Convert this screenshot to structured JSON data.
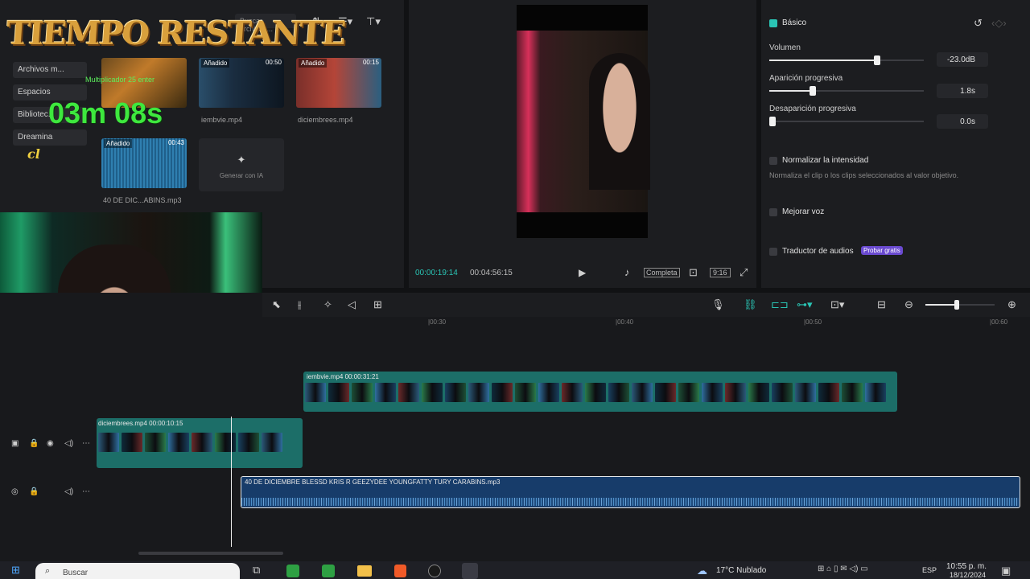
{
  "overlay": {
    "title": "TIEMPO RESTANTE",
    "countdown": "03m 08s",
    "small_text": "Multiplicador 25 enter",
    "signature": "cl"
  },
  "media_panel": {
    "search_placeholder": "Buscar archivos...",
    "sidebar": [
      "Archivos m...",
      "Espacios",
      "Bibliotec...",
      "Dreamina"
    ],
    "items": [
      {
        "name": "",
        "tag": "",
        "duration": ""
      },
      {
        "name": "iembvie.mp4",
        "tag": "Añadido",
        "duration": "00:50"
      },
      {
        "name": "diciembrees.mp4",
        "tag": "Añadido",
        "duration": "00:15"
      },
      {
        "name": "40 DE DIC...ABINS.mp3",
        "tag": "Añadido",
        "duration": "00:43"
      }
    ],
    "generate_label": "Generar con IA"
  },
  "preview": {
    "current_time": "00:00:19:14",
    "total_time": "00:04:56:15",
    "complete_label": "Completa",
    "ratio_label": "9:16"
  },
  "inspector": {
    "section": "Básico",
    "volume_label": "Volumen",
    "volume_value": "-23.0dB",
    "volume_level": 0.7,
    "fade_in_label": "Aparición progresiva",
    "fade_in_value": "1.8s",
    "fade_in_level": 0.28,
    "fade_out_label": "Desaparición progresiva",
    "fade_out_value": "0.0s",
    "fade_out_level": 0.0,
    "normalize_label": "Normalizar la intensidad",
    "normalize_desc": "Normaliza el clip o los clips seleccionados al valor objetivo.",
    "enhance_label": "Mejorar voz",
    "translate_label": "Traductor de audios",
    "translate_badge": "Probar gratis"
  },
  "timeline": {
    "ruler": [
      "|00:30",
      "|00:40",
      "|00:50",
      "|00:60"
    ],
    "clip_main": "iembvie.mp4   00:00:31:21",
    "clip_secondary": "diciembrees.mp4   00:00:10:15",
    "clip_audio": "40 DE DICIEMBRE  BLESSD  KRIS R  GEEZYDEE  YOUNGFATTY  TURY  CARABINS.mp3",
    "zoom_level": 0.45
  },
  "taskbar": {
    "search_placeholder": "Buscar",
    "weather": "17°C  Nublado",
    "lang": "ESP",
    "time": "10:55 p. m.",
    "date": "18/12/2024"
  }
}
